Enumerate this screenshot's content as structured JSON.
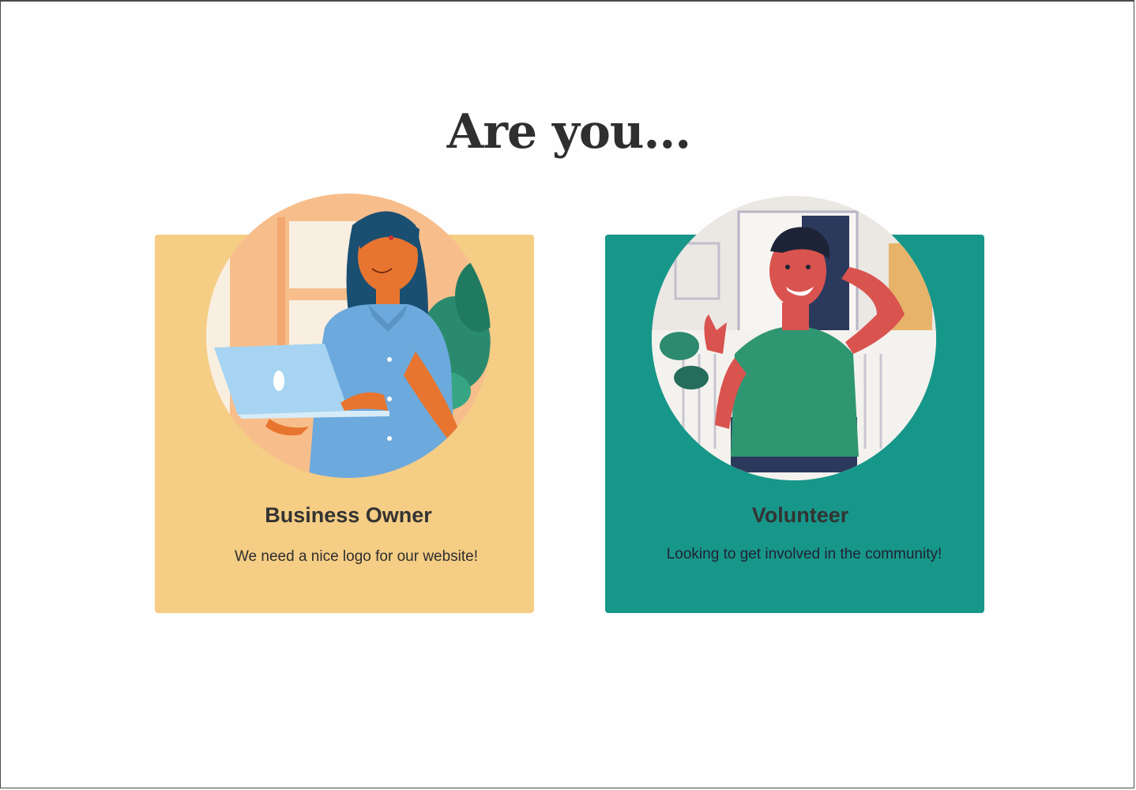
{
  "heading": "Are you...",
  "cards": [
    {
      "title": "Business Owner",
      "description": "We need a nice logo for our website!",
      "background_color": "#f5cd84",
      "illustration": "woman-with-laptop-illustration"
    },
    {
      "title": "Volunteer",
      "description": "Looking to get involved in the community!",
      "background_color": "#17978a",
      "illustration": "man-in-wheelchair-illustration"
    }
  ]
}
